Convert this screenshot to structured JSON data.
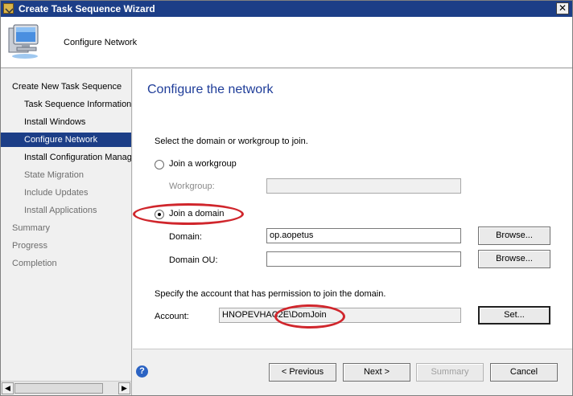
{
  "window": {
    "title": "Create Task Sequence Wizard",
    "close_glyph": "✕"
  },
  "header": {
    "title": "Configure Network",
    "icon": "computer-icon"
  },
  "nav": {
    "items": [
      {
        "label": "Create New Task Sequence",
        "level": "top",
        "state": "normal"
      },
      {
        "label": "Task Sequence Information",
        "level": "sub",
        "state": "normal"
      },
      {
        "label": "Install Windows",
        "level": "sub",
        "state": "normal"
      },
      {
        "label": "Configure Network",
        "level": "sub",
        "state": "selected"
      },
      {
        "label": "Install Configuration Manag",
        "level": "sub",
        "state": "normal"
      },
      {
        "label": "State Migration",
        "level": "sub",
        "state": "dim"
      },
      {
        "label": "Include Updates",
        "level": "sub",
        "state": "dim"
      },
      {
        "label": "Install Applications",
        "level": "sub",
        "state": "dim"
      },
      {
        "label": "Summary",
        "level": "top",
        "state": "dim"
      },
      {
        "label": "Progress",
        "level": "top",
        "state": "dim"
      },
      {
        "label": "Completion",
        "level": "top",
        "state": "dim"
      }
    ],
    "scroll_left": "◀",
    "scroll_right": "▶"
  },
  "main": {
    "title": "Configure the network",
    "select_prompt": "Select the domain or workgroup to join.",
    "workgroup_option": "Join a workgroup",
    "workgroup_label": "Workgroup:",
    "workgroup_value": "",
    "domain_option": "Join a domain",
    "domain_label": "Domain:",
    "domain_value": "op.aopetus",
    "domain_ou_label": "Domain OU:",
    "domain_ou_value": "",
    "browse_label": "Browse...",
    "account_prompt": "Specify the account that has permission to join the domain.",
    "account_label": "Account:",
    "account_value": "HNOPEVHAC2E\\DomJoin",
    "set_label": "Set..."
  },
  "footer": {
    "help": "?",
    "previous": "< Previous",
    "next": "Next >",
    "summary": "Summary",
    "cancel": "Cancel"
  },
  "annotation_color": "#d0262c"
}
